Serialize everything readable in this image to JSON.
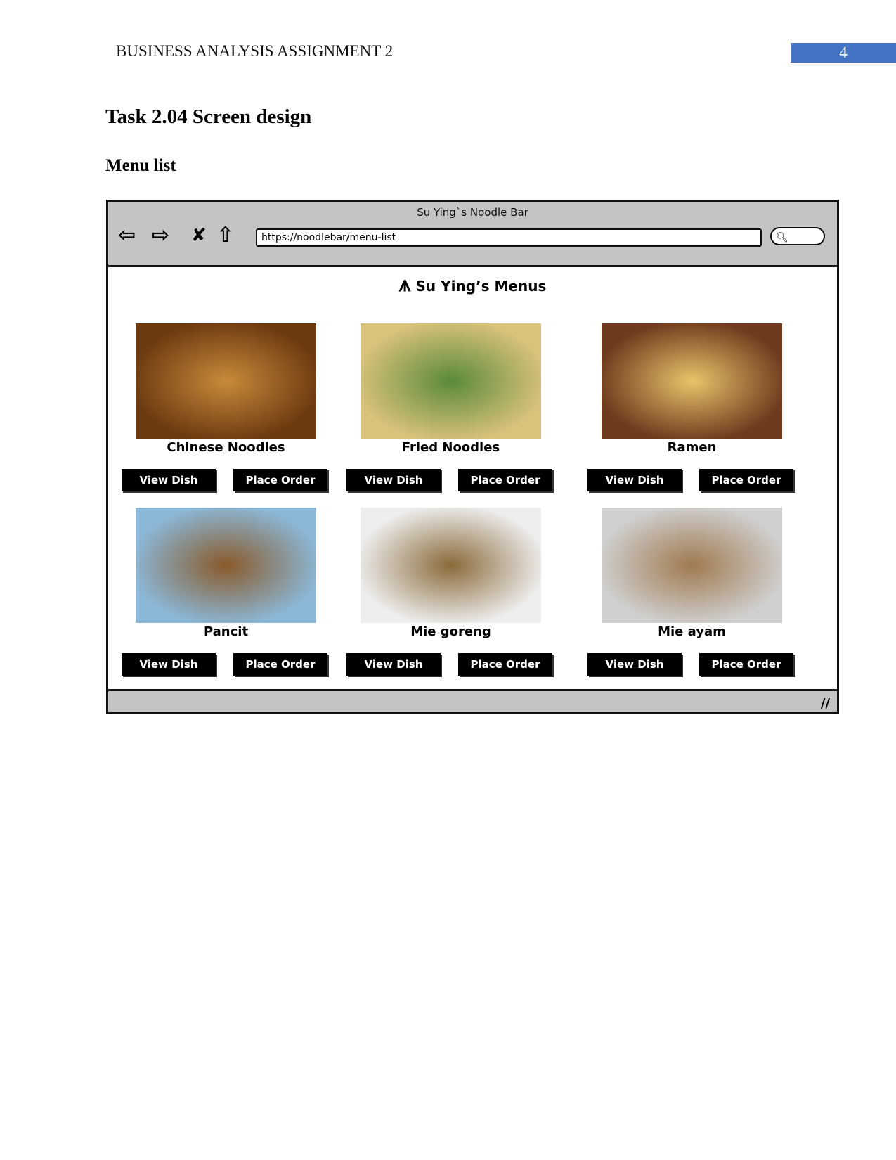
{
  "header": {
    "title": "BUSINESS ANALYSIS ASSIGNMENT 2",
    "page_number": "4",
    "accent": "#4472c4"
  },
  "headings": {
    "task": "Task 2.04 Screen design",
    "section": "Menu list"
  },
  "mockup": {
    "window_title": "Su Ying`s Noodle Bar",
    "url": "https://noodlebar/menu-list",
    "brand": "Su Ying’s Menus",
    "nav_icons": [
      "back-arrow-icon",
      "forward-arrow-icon",
      "close-icon",
      "home-icon",
      "search-icon"
    ],
    "dishes": [
      {
        "name": "Chinese Noodles",
        "view": "View Dish",
        "order": "Place Order",
        "colors": [
          "#6b3a10",
          "#c98a3a"
        ]
      },
      {
        "name": "Fried Noodles",
        "view": "View Dish",
        "order": "Place Order",
        "colors": [
          "#d9c27a",
          "#5a8a3a"
        ]
      },
      {
        "name": "Ramen",
        "view": "View Dish",
        "order": "Place Order",
        "colors": [
          "#6e3b1e",
          "#e9c46a"
        ]
      },
      {
        "name": "Pancit",
        "view": "View Dish",
        "order": "Place Order",
        "colors": [
          "#8bb8d8",
          "#8a5a2a"
        ]
      },
      {
        "name": "Mie goreng",
        "view": "View Dish",
        "order": "Place Order",
        "colors": [
          "#eeeeee",
          "#8a6a3a"
        ]
      },
      {
        "name": "Mie ayam",
        "view": "View Dish",
        "order": "Place Order",
        "colors": [
          "#d0d0d0",
          "#a07a50"
        ]
      }
    ]
  }
}
